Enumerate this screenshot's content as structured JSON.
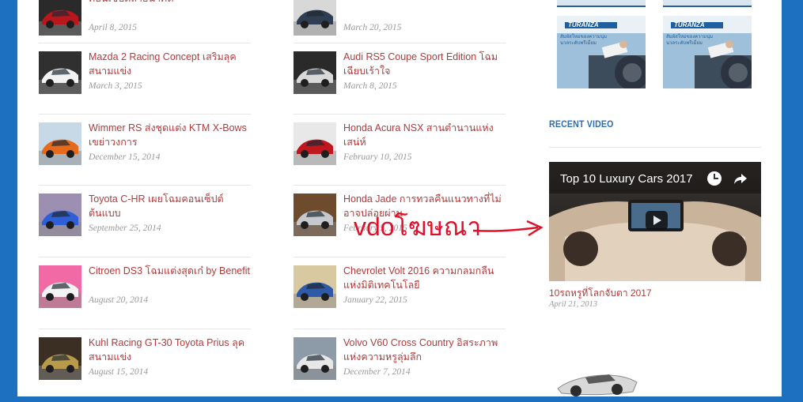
{
  "left_column": [
    {
      "title": "คอนเซ็ปต์ล้ำอนาคต",
      "date": "April 8, 2015",
      "thumb": "red-car"
    },
    {
      "title": "Mazda 2 Racing Concept เสริมลุคสนามแข่ง",
      "date": "March 3, 2015",
      "thumb": "white-car"
    },
    {
      "title": "Wimmer RS ส่งชุดแต่ง KTM X-Bows เขย่าวงการ",
      "date": "December 15, 2014",
      "thumb": "orange-car"
    },
    {
      "title": "Toyota C-HR เผยโฉมคอนเซ็ปต์ต้นแบบ",
      "date": "September 25, 2014",
      "thumb": "blue-car"
    },
    {
      "title": "Citroen DS3 โฉมแต่งสุดเก๋ by Benefit",
      "date": "August 20, 2014",
      "thumb": "pink-car"
    },
    {
      "title": "Kuhl Racing GT-30 Toyota Prius ลุคสนามแข่ง",
      "date": "August 15, 2014",
      "thumb": "gold-car"
    }
  ],
  "right_column": [
    {
      "title": "",
      "date": "March 20, 2015",
      "thumb": "dark-car"
    },
    {
      "title": "Audi RS5 Coupe Sport Edition โฉมเฉียบเร้าใจ",
      "date": "March 8, 2015",
      "thumb": "silver-car"
    },
    {
      "title": "Honda Acura NSX สานตำนานแห่งเสน่ห์",
      "date": "February 10, 2015",
      "thumb": "red-sport-car"
    },
    {
      "title": "Honda Jade การทวลคืนแนวทางที่ไม่อาจปล่อยผ่าน",
      "date": "February 5, 2015",
      "thumb": "grey-car"
    },
    {
      "title": "Chevrolet Volt 2016 ความกลมกลืนแห่งมิติเทคโนโลยี",
      "date": "January 22, 2015",
      "thumb": "blue-sedan"
    },
    {
      "title": "Volvo V60 Cross Country อิสระภาพแห่งความหรูลุ่มลึก",
      "date": "December 7, 2014",
      "thumb": "white-wagon"
    }
  ],
  "sidebar": {
    "section_title": "RECENT VIDEO",
    "ads": [
      {
        "brand": "TURANZA",
        "tagline": "สัมผัสใหม่ของความนุ่มนวลระดับพรีเมี่ยม"
      },
      {
        "brand": "TURANZA",
        "tagline": "สัมผัสใหม่ของความนุ่มนวลระดับพรีเมี่ยม"
      }
    ],
    "video": {
      "title": "Top 10 Luxury Cars 2017",
      "caption": "10รถหรูที่โลกจับตา 2017",
      "date": "April 21, 2013"
    }
  },
  "annotation": {
    "text": "vdoโฆษณา",
    "color": "#e0102a"
  },
  "colors": {
    "background": "#1d6fbf",
    "link": "#b33a3a",
    "date": "#999999",
    "heading": "#2a6fb0"
  }
}
